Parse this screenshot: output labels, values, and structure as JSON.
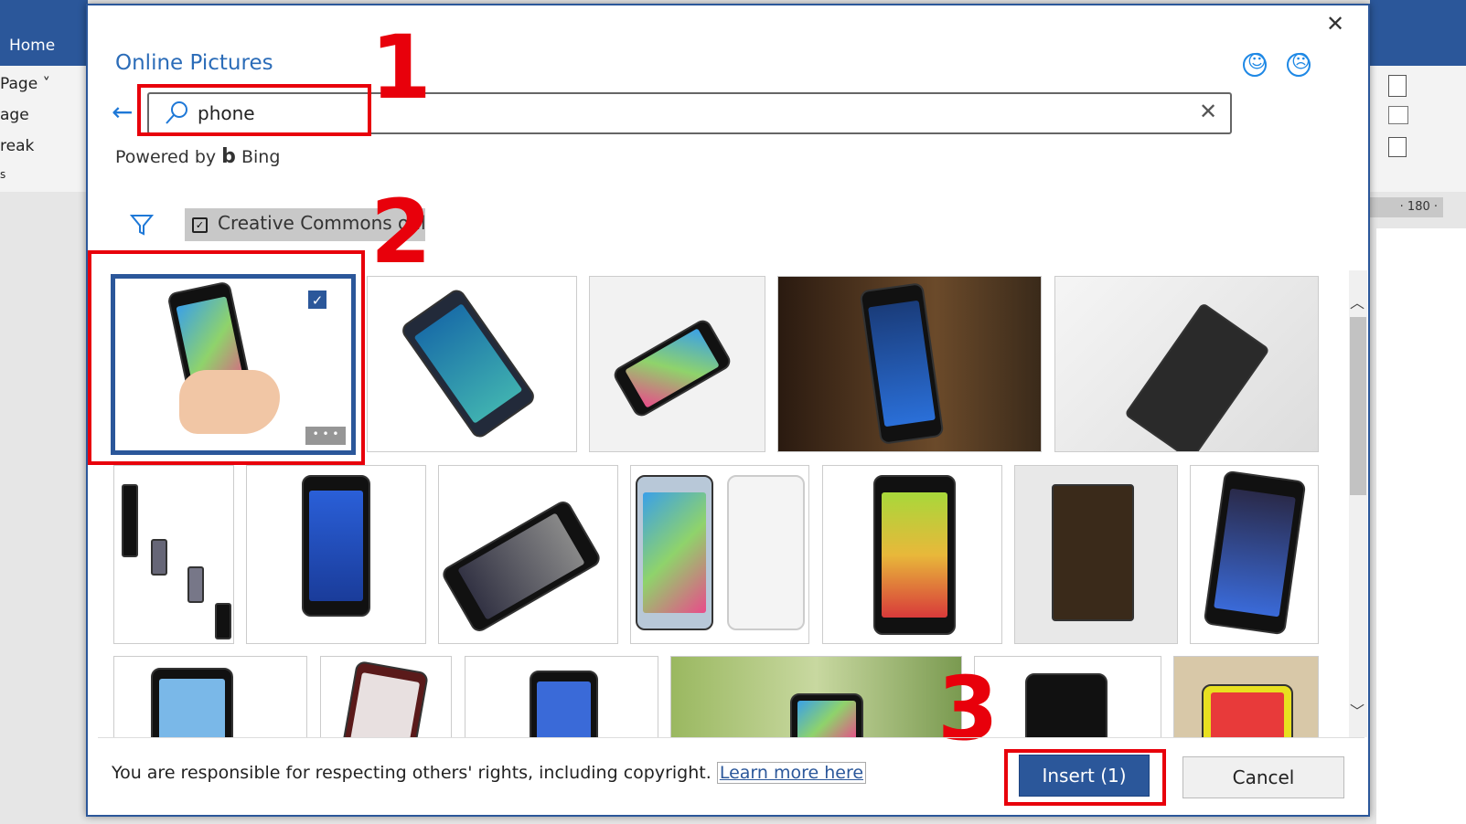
{
  "word": {
    "home_tab": "Home",
    "ribbon_left": [
      "Page ˅",
      "age",
      "reak",
      "s"
    ],
    "ruler_label": "· 180 ·"
  },
  "dialog": {
    "title": "Online Pictures",
    "close_icon": "close-icon",
    "feedback": {
      "smile": "☺",
      "frown": "☹"
    },
    "search": {
      "value": "phone",
      "clear": "✕",
      "back": "←"
    },
    "powered_by": "Powered by",
    "bing": "Bing",
    "filter": {
      "label": "Creative Commons only",
      "checked": true
    },
    "results": {
      "selected_count": 1,
      "query": "phone"
    },
    "footer": {
      "notice": "You are responsible for respecting others' rights, including copyright.",
      "learn_more": "Learn more here"
    },
    "insert_label": "Insert (1)",
    "cancel_label": "Cancel"
  },
  "annotations": {
    "step1": "1",
    "step2": "2",
    "step3": "3",
    "color": "#e8000b"
  }
}
